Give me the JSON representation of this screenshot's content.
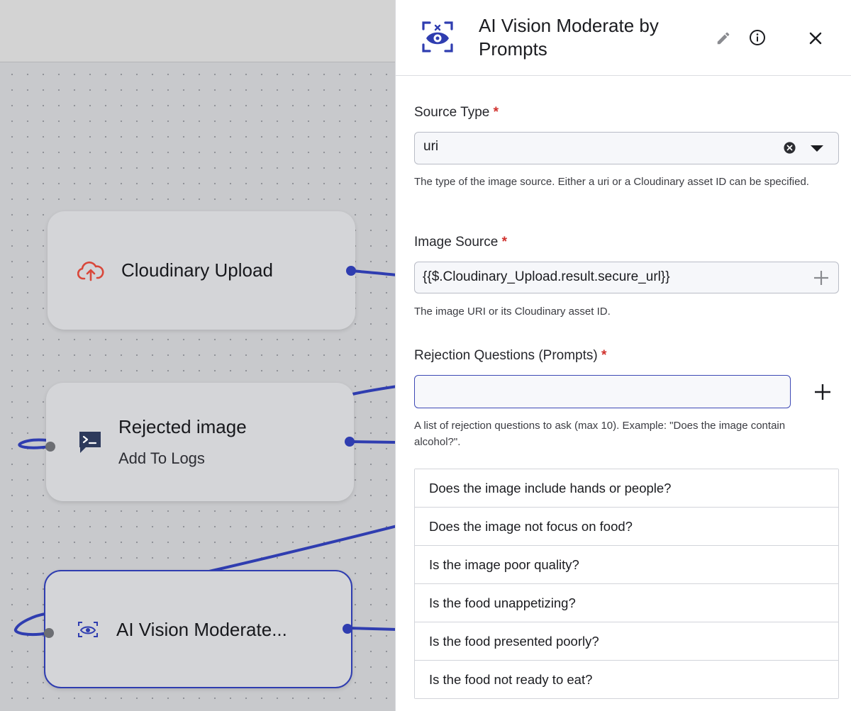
{
  "canvas": {
    "nodes": {
      "upload": {
        "title": "Cloudinary Upload",
        "icon": "cloud-upload-icon"
      },
      "rejected": {
        "title": "Rejected image",
        "subtitle": "Add To Logs",
        "icon": "terminal-log-icon"
      },
      "vision": {
        "title": "AI Vision Moderate...",
        "icon": "ai-vision-eye-icon"
      }
    }
  },
  "panel": {
    "title": "AI Vision Moderate by Prompts",
    "icon": "ai-vision-eye-icon",
    "actions": {
      "edit": "pencil-icon",
      "info": "info-icon",
      "close": "close-icon"
    },
    "source_type": {
      "label": "Source Type",
      "required": "*",
      "value": "uri",
      "help": "The type of the image source. Either a uri or a Cloudinary asset ID can be specified."
    },
    "image_source": {
      "label": "Image Source",
      "required": "*",
      "value": "{{$.Cloudinary_Upload.result.secure_url}}",
      "help": "The image URI or its Cloudinary asset ID."
    },
    "rejection_questions": {
      "label": "Rejection Questions (Prompts)",
      "required": "*",
      "value": "",
      "help": "A list of rejection questions to ask (max 10). Example: \"Does the image contain alcohol?\".",
      "items": [
        "Does the image include hands or people?",
        "Does the image not focus on food?",
        "Is the image poor quality?",
        "Is the food unappetizing?",
        "Is the food presented poorly?",
        "Is the food not ready to eat?"
      ]
    }
  },
  "colors": {
    "accent": "#2f3db0",
    "required": "#d0312d",
    "upload_icon": "#d9473a",
    "log_icon": "#2d3a5c"
  }
}
